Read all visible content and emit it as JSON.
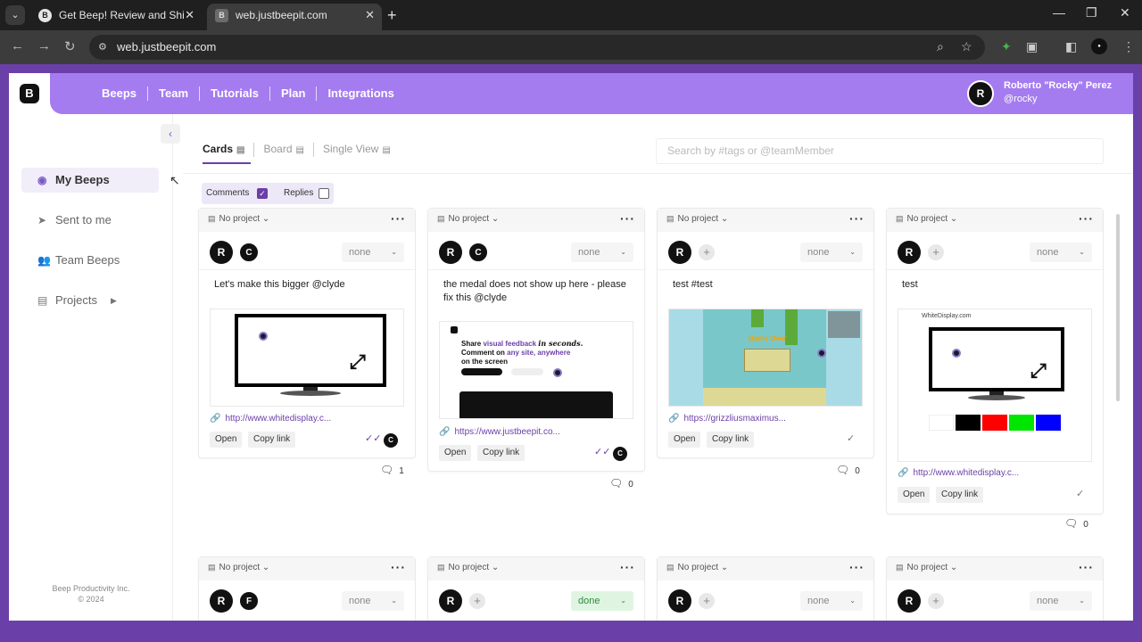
{
  "browser": {
    "tabs": [
      {
        "title": "Get Beep! Review and Ship Web",
        "favicon": "B"
      },
      {
        "title": "web.justbeepit.com",
        "favicon": "B"
      }
    ],
    "url": "web.justbeepit.com"
  },
  "header": {
    "logo": "B",
    "nav": [
      "Beeps",
      "Team",
      "Tutorials",
      "Plan",
      "Integrations"
    ],
    "user": {
      "name": "Roberto \"Rocky\" Perez",
      "handle": "@rocky",
      "avatar": "R"
    }
  },
  "sidebar": {
    "items": [
      {
        "label": "My Beeps",
        "icon": "user-circle-icon"
      },
      {
        "label": "Sent to me",
        "icon": "send-icon"
      },
      {
        "label": "Team Beeps",
        "icon": "team-icon"
      },
      {
        "label": "Projects",
        "icon": "folder-icon"
      }
    ],
    "footer_line1": "Beep Productivity Inc.",
    "footer_line2": "© 2024"
  },
  "views": [
    "Cards",
    "Board",
    "Single View"
  ],
  "search": {
    "placeholder": "Search by #tags or @teamMember"
  },
  "filters": {
    "comments_label": "Comments",
    "comments_checked": true,
    "replies_label": "Replies",
    "replies_checked": false
  },
  "cards": [
    {
      "project": "No project",
      "status": "none",
      "comment": "Let's make this bigger @clyde",
      "link": "http://www.whitedisplay.c...",
      "open": "Open",
      "copy": "Copy link",
      "comments": "1"
    },
    {
      "project": "No project",
      "status": "none",
      "comment": "the medal does not show up here - please fix this @clyde",
      "link": "https://www.justbeepit.co...",
      "open": "Open",
      "copy": "Copy link",
      "comments": "0"
    },
    {
      "project": "No project",
      "status": "none",
      "comment": "test #test",
      "link": "https://grizzliusmaximus...",
      "open": "Open",
      "copy": "Copy link",
      "comments": "0"
    },
    {
      "project": "No project",
      "status": "none",
      "comment": "test",
      "link": "http://www.whitedisplay.c...",
      "open": "Open",
      "copy": "Copy link",
      "comments": "0"
    }
  ],
  "cards_row2": [
    {
      "project": "No project",
      "status": "none"
    },
    {
      "project": "No project",
      "status": "done"
    },
    {
      "project": "No project",
      "status": "none"
    },
    {
      "project": "No project",
      "status": "none"
    }
  ],
  "shot2": {
    "headline": "Share",
    "headline_em": "visual feedback",
    "headline_em2": "in seconds.",
    "line2": "Comment on",
    "line2_em": "any site, anywhere",
    "line3": "on the screen"
  },
  "shot3": {
    "banner": "Game Over"
  },
  "shot4": {
    "site": "WhiteDisplay.com"
  },
  "colors": {
    "brand": "#6b3fa8",
    "nav": "#a47cf0",
    "done_bg": "#dff5e1"
  }
}
